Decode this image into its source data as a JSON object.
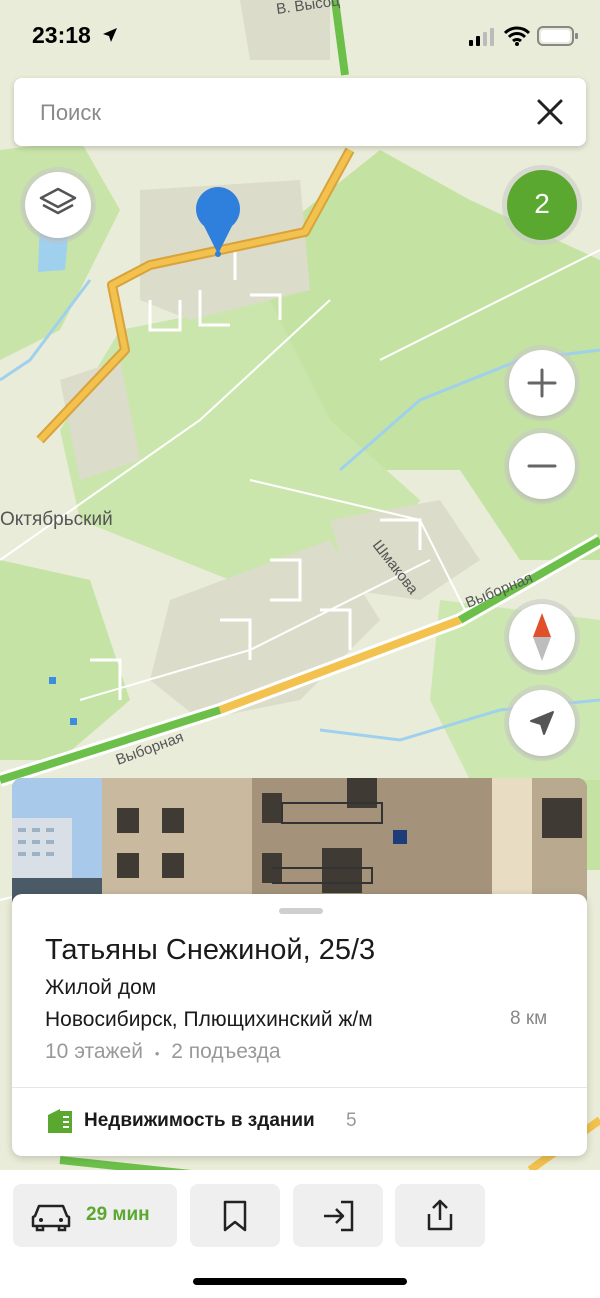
{
  "status_bar": {
    "time": "23:18"
  },
  "search": {
    "placeholder": "Поиск"
  },
  "map": {
    "labels": {
      "district": "Октябрьский",
      "street_top": "В. Высоц",
      "street_shmakova": "Шмакова",
      "street_vybornaya_right": "Выборная",
      "street_vybornaya_left": "Выборная"
    },
    "cluster_count": "2",
    "colors": {
      "road_yellow": "#f2c14e",
      "road_green": "#6cc04a",
      "green_area": "#bfe0a0",
      "accent_green": "#5aa82f",
      "pin_blue": "#2f7fdd"
    }
  },
  "place": {
    "title": "Татьяны Снежиной, 25/3",
    "type": "Жилой дом",
    "address": "Новосибирск, Плющихинский ж/м",
    "distance": "8 км",
    "floors": "10 этажей",
    "separator": "•",
    "entrances": "2 подъезда",
    "realty_label": "Недвижимость в здании",
    "realty_count": "5"
  },
  "toolbar": {
    "route_time": "29 мин"
  }
}
